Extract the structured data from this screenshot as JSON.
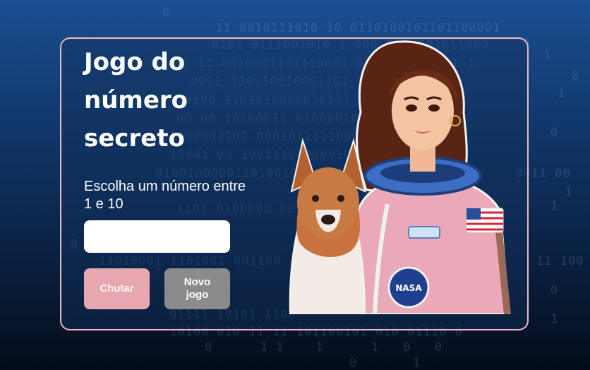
{
  "page": {
    "title": "Jogo do número secreto",
    "subtitle": "Escolha um número entre 1 e 10",
    "input": {
      "value": "",
      "placeholder": ""
    },
    "buttons": {
      "guess_label": "Chutar",
      "new_game_label": "Novo jogo"
    }
  },
  "illustration": {
    "subject": "astronaut-woman-with-dog",
    "patch_label": "NASA"
  },
  "colors": {
    "background_top": "#1b4e92",
    "background_bottom": "#050c1a",
    "card_border": "#e9b9c5",
    "guess_button": "#e7a7b1",
    "new_game_button": "#8b8b8b",
    "text": "#ffffff"
  }
}
